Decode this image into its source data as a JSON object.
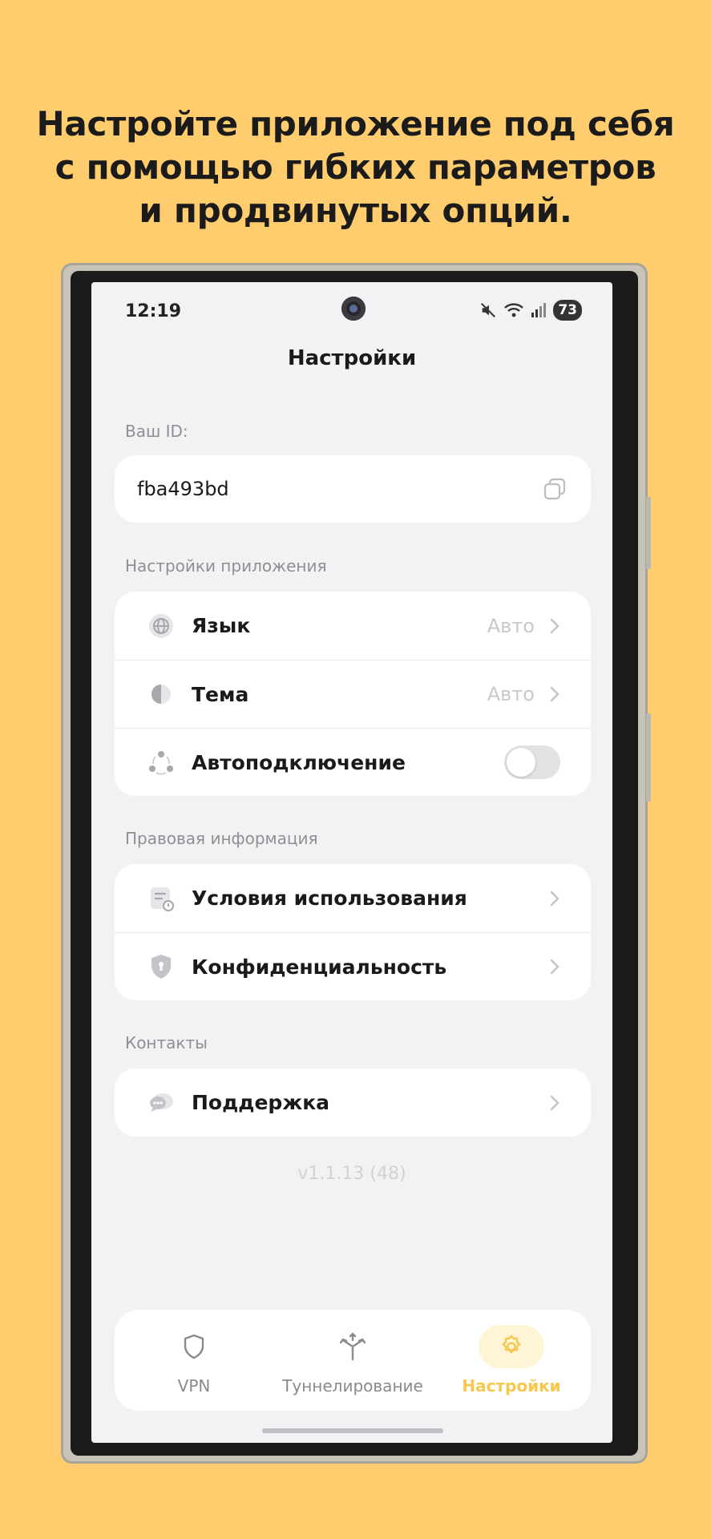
{
  "promo": {
    "line1": "Настройте приложение под себя",
    "line2": "с помощью гибких параметров",
    "line3": "и продвинутых опций."
  },
  "status_bar": {
    "time": "12:19",
    "battery": "73"
  },
  "header": {
    "title": "Настройки"
  },
  "id_section": {
    "label": "Ваш ID:",
    "value": "fba493bd",
    "copy_icon": "copy-icon"
  },
  "app_settings": {
    "label": "Настройки приложения",
    "items": [
      {
        "label": "Язык",
        "value": "Авто",
        "icon": "globe-icon"
      },
      {
        "label": "Тема",
        "value": "Авто",
        "icon": "half-circle-icon"
      },
      {
        "label": "Автоподключение",
        "icon": "share-nodes-icon",
        "toggle": false
      }
    ]
  },
  "legal": {
    "label": "Правовая информация",
    "items": [
      {
        "label": "Условия использования",
        "icon": "document-icon"
      },
      {
        "label": "Конфиденциальность",
        "icon": "shield-lock-icon"
      }
    ]
  },
  "contacts": {
    "label": "Контакты",
    "items": [
      {
        "label": "Поддержка",
        "icon": "chat-icon"
      }
    ]
  },
  "version": "v1.1.13 (48)",
  "nav": {
    "items": [
      {
        "label": "VPN",
        "icon": "shield-icon"
      },
      {
        "label": "Туннелирование",
        "icon": "split-arrows-icon"
      },
      {
        "label": "Настройки",
        "icon": "gear-icon",
        "active": true
      }
    ]
  },
  "colors": {
    "accent": "#F7C84E",
    "background": "#FFCD6E",
    "screen": "#F2F2F4"
  }
}
